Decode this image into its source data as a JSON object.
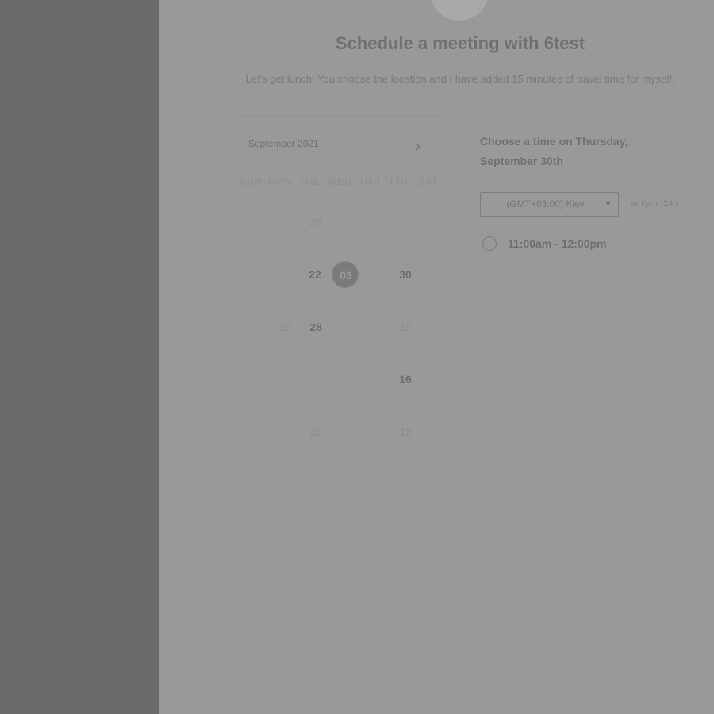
{
  "header": {
    "title": "Schedule a meeting with 6test",
    "description": "Let's get lunch! You choose the location and I have added 15 minutes of travel time for myself."
  },
  "calendar": {
    "month_label": "September 2021",
    "prev_icon": "‹",
    "next_icon": "›",
    "weekdays": [
      "SUN",
      "MON",
      "TUE",
      "WED",
      "THU",
      "FRI",
      "SAT"
    ],
    "days": [
      {
        "label": "26",
        "state": "disabled"
      },
      {
        "label": "22",
        "state": "available"
      },
      {
        "label": "03",
        "state": "selected"
      },
      {
        "label": "30",
        "state": "available"
      },
      {
        "label": "20",
        "state": "disabled"
      },
      {
        "label": "28",
        "state": "available"
      },
      {
        "label": "12",
        "state": "disabled"
      },
      {
        "label": "16",
        "state": "available"
      },
      {
        "label": "26",
        "state": "disabled"
      },
      {
        "label": "12",
        "state": "disabled"
      }
    ]
  },
  "times": {
    "heading": "Choose a time on Thursday, September 30th",
    "timezone": "(GMT+03:00) Kiev",
    "format_ampm": "am/pm",
    "format_24h": "24h",
    "slots": [
      {
        "label": "11:00am - 12:00pm"
      }
    ]
  },
  "colors": {
    "sidebar": "#6a6a6a",
    "main_background": "#999999",
    "text_dark": "#707070"
  }
}
